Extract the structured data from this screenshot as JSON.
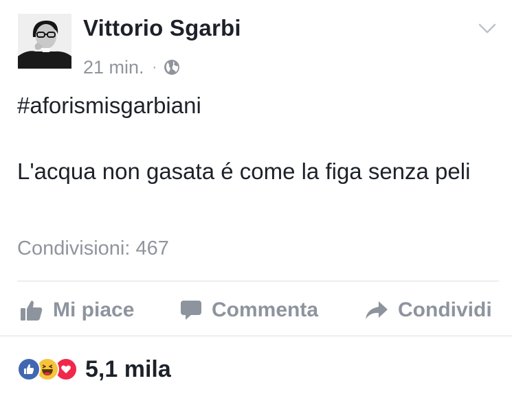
{
  "post": {
    "author": "Vittorio Sgarbi",
    "time": "21 min.",
    "separator": "·",
    "audience_icon": "globe-icon",
    "hashtag": "#aforismisgarbiani",
    "text": "L'acqua non gasata é come la figa senza peli",
    "shares": "Condivisioni: 467"
  },
  "actions": {
    "like": "Mi piace",
    "comment": "Commenta",
    "share": "Condividi"
  },
  "reactions": {
    "icons": [
      "like-icon",
      "haha-icon",
      "love-icon"
    ],
    "count": "5,1 mila"
  },
  "colors": {
    "text": "#1d2129",
    "secondary": "#90949c",
    "like_blue": "#4267b2",
    "haha_yellow": "#f7c33b",
    "love_red": "#f0284a",
    "divider": "#dddfe2"
  }
}
